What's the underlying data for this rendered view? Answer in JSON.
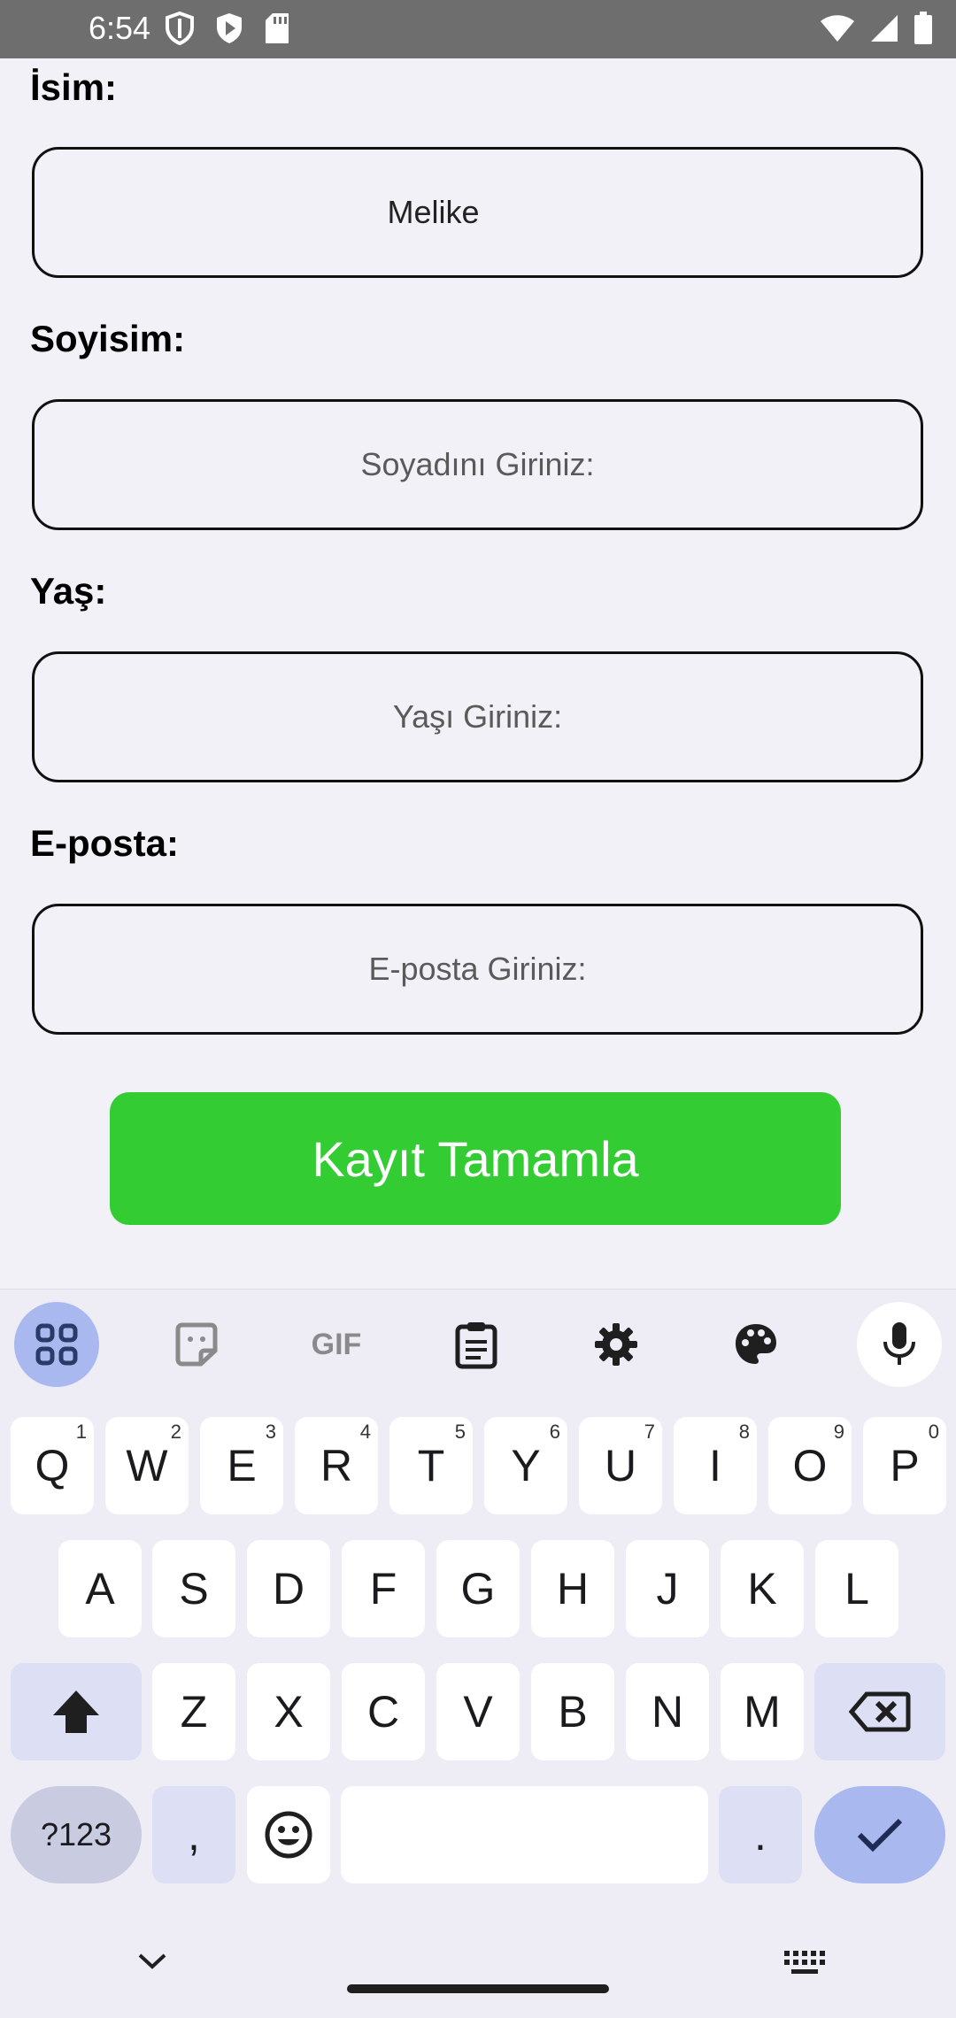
{
  "status_bar": {
    "time": "6:54",
    "icons_left": [
      "shield-icon",
      "play-store-icon",
      "sd-card-icon"
    ],
    "icons_right": [
      "wifi-icon",
      "signal-icon",
      "battery-icon"
    ]
  },
  "form": {
    "fields": [
      {
        "label": "İsim:",
        "value": "Melike",
        "placeholder": ""
      },
      {
        "label": "Soyisim:",
        "value": "",
        "placeholder": "Soyadını Giriniz:"
      },
      {
        "label": "Yaş:",
        "value": "",
        "placeholder": "Yaşı Giriniz:"
      },
      {
        "label": "E-posta:",
        "value": "",
        "placeholder": "E-posta Giriniz:"
      }
    ],
    "submit_label": "Kayıt Tamamla",
    "accent_color": "#33cc33"
  },
  "keyboard": {
    "toolbar": [
      "apps-grid-icon",
      "sticker-icon",
      "gif-icon",
      "clipboard-icon",
      "settings-gear-icon",
      "palette-icon",
      "microphone-icon"
    ],
    "gif_label": "GIF",
    "row1": [
      {
        "k": "Q",
        "h": "1"
      },
      {
        "k": "W",
        "h": "2"
      },
      {
        "k": "E",
        "h": "3"
      },
      {
        "k": "R",
        "h": "4"
      },
      {
        "k": "T",
        "h": "5"
      },
      {
        "k": "Y",
        "h": "6"
      },
      {
        "k": "U",
        "h": "7"
      },
      {
        "k": "I",
        "h": "8"
      },
      {
        "k": "O",
        "h": "9"
      },
      {
        "k": "P",
        "h": "0"
      }
    ],
    "row2": [
      "A",
      "S",
      "D",
      "F",
      "G",
      "H",
      "J",
      "K",
      "L"
    ],
    "row3": [
      "Z",
      "X",
      "C",
      "V",
      "B",
      "N",
      "M"
    ],
    "symbols_label": "?123",
    "comma_label": ",",
    "period_label": ".",
    "space_label": ""
  }
}
